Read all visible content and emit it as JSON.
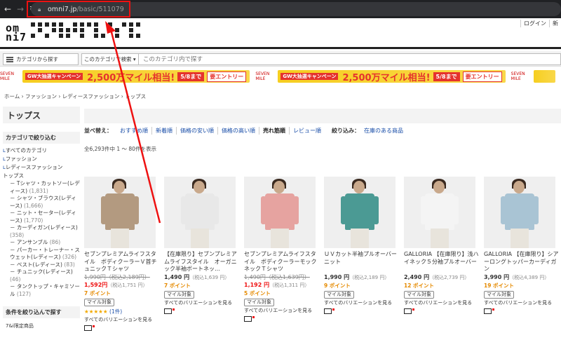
{
  "browser": {
    "url_host": "omni7.jp",
    "url_path": "/basic/511079"
  },
  "header": {
    "logo_top": "om",
    "logo_bottom": "ni7",
    "links": [
      "ログイン",
      "新"
    ]
  },
  "search": {
    "category_button": "カテゴリから探す",
    "scope_label": "このカテゴリで検索",
    "placeholder": "このカテゴリ内で探す"
  },
  "banner": {
    "campaign_tag": "GW大抽選キャンペーン",
    "headline": "2,500万マイル相当!",
    "deadline": "5/8まで",
    "entry": "要エントリー",
    "brand_mark": "SEVEN MILE"
  },
  "breadcrumb": "ホーム › ファッション › レディースファッション › トップス",
  "sidebar": {
    "title": "トップス",
    "narrow_heading": "カテゴリで絞り込む",
    "items": [
      {
        "label": "すべてのカテゴリ",
        "level": 0
      },
      {
        "label": "ファッション",
        "level": 0
      },
      {
        "label": "レディースファッション",
        "level": 0
      },
      {
        "label": "トップス",
        "level": 0
      }
    ],
    "subitems": [
      {
        "label": "－ Tシャツ・カットソー(レディース)",
        "count": "(1,831)"
      },
      {
        "label": "－ シャツ・ブラウス(レディース)",
        "count": "(1,666)"
      },
      {
        "label": "－ ニット・セーター(レディース)",
        "count": "(1,770)"
      },
      {
        "label": "－ カーディガン(レディース)",
        "count": "(358)"
      },
      {
        "label": "－ アンサンブル",
        "count": "(86)"
      },
      {
        "label": "－ パーカー・トレーナー・スウェット(レディース)",
        "count": "(326)"
      },
      {
        "label": "－ ベスト(レディース)",
        "count": "(83)"
      },
      {
        "label": "－ チュニック(レディース)",
        "count": "(46)"
      },
      {
        "label": "－ タンクトップ・キャミソール",
        "count": "(127)"
      }
    ],
    "filter_heading": "条件を絞り込んで探す",
    "extra": "7&i限定商品"
  },
  "sort": {
    "label": "並べ替え：",
    "options": [
      "おすすめ順",
      "新着順",
      "価格の安い順",
      "価格の高い順",
      "売れ筋順",
      "レビュー順"
    ],
    "selected_index": 4,
    "refine_label": "絞り込み：",
    "refine_option": "在庫のある商品"
  },
  "count_line": "全6,293件中 1 ～ 80件を表示",
  "products": [
    {
      "name": "セブンプレミアムライフスタイル　ボディクーラーＶ首チュニックＴシャツ",
      "orig_price": "1,990円",
      "orig_tax": "（税込2,189円）",
      "price": "1,592円",
      "price_tax": "（税込1,751 円）",
      "points": "7 ポイント",
      "badge": "マイル対象",
      "stars": "★★★★★",
      "review_count": "(1件)",
      "variation": "すべてのバリエーションを見る",
      "color": "#b39a80"
    },
    {
      "name": "【在庫限り】セブンプレミアムライフスタイル　オーガニック半袖ボートネッ…",
      "orig_price": "",
      "orig_tax": "",
      "price": "1,490 円",
      "price_tax": "（税込1,639 円）",
      "points": "7 ポイント",
      "badge": "マイル対象",
      "stars": "",
      "review_count": "",
      "variation": "すべてのバリエーションを見る",
      "color": "#e8e8e8"
    },
    {
      "name": "セブンプレミアムライフスタイル　ボディクーラーモックネックＴシャツ",
      "orig_price": "1,490円",
      "orig_tax": "（税込1,639円）",
      "price": "1,192 円",
      "price_tax": "（税込1,311 円）",
      "points": "5 ポイント",
      "badge": "マイル対象",
      "stars": "",
      "review_count": "",
      "variation": "すべてのバリエーションを見る",
      "color": "#e6a3a0"
    },
    {
      "name": "ＵＶカット半袖プルオーバーニット",
      "orig_price": "",
      "orig_tax": "",
      "price": "1,990 円",
      "price_tax": "（税込2,189 円）",
      "points": "9 ポイント",
      "badge": "マイル対象",
      "stars": "",
      "review_count": "",
      "variation": "すべてのバリエーションを見る",
      "color": "#4b9a94"
    },
    {
      "name": "GALLORIA 【在庫限り】浅ハイネック５分袖プルオーバー",
      "orig_price": "",
      "orig_tax": "",
      "price": "2,490 円",
      "price_tax": "（税込2,739 円）",
      "points": "12 ポイント",
      "badge": "マイル対象",
      "stars": "",
      "review_count": "",
      "variation": "すべてのバリエーションを見る",
      "color": "#f4f4f4"
    },
    {
      "name": "GALLORIA 【在庫限り】シアーロングトッパーカーディガン",
      "orig_price": "",
      "orig_tax": "",
      "price": "3,990 円",
      "price_tax": "（税込4,389 円）",
      "points": "19 ポイント",
      "badge": "マイル対象",
      "stars": "",
      "review_count": "",
      "variation": "すべてのバリエーションを見る",
      "color": "#a9c4d4"
    }
  ],
  "colors": {
    "price_red": "#e11111",
    "points_orange": "#e58a00",
    "link_blue": "#1a4ea8",
    "annotation_red": "#e11111"
  }
}
